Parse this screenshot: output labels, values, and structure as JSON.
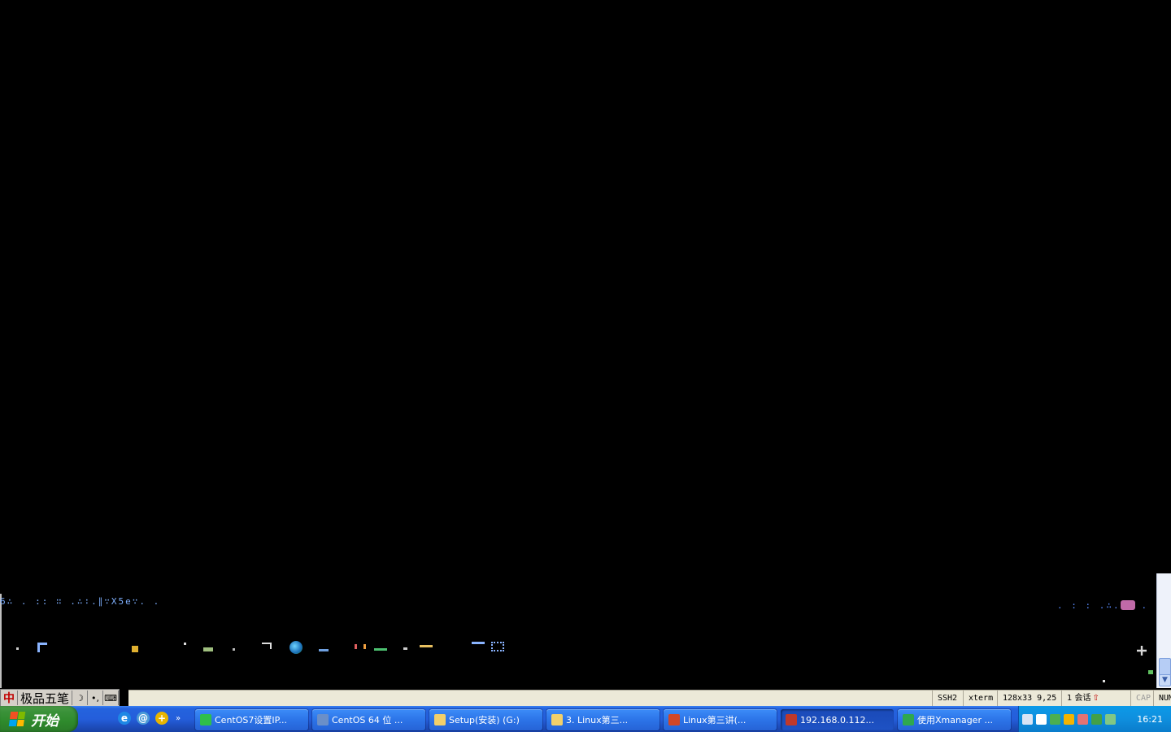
{
  "terminal": {
    "garbled_line_left": "6∴ . :: ∷ .∴∶.∥∵Χ5e∵. .",
    "garbled_line_right": ". : : .∴.:. ."
  },
  "ime": {
    "logo": "中",
    "name": "极品五笔",
    "moon": "☽",
    "punct": "•,",
    "keyboard": "⌨"
  },
  "status_bar": {
    "protocol": "SSH2",
    "terminal_type": "xterm",
    "size_cursor": "128x33  9,25",
    "sessions": "1 会话",
    "sessions_arrow": "⇧",
    "cap": "CAP",
    "num": "NUM"
  },
  "taskbar": {
    "start_label": "开始",
    "quick_launch": [
      {
        "icon": "ie-icon",
        "glyph": "e",
        "color": "#1e88e5"
      },
      {
        "icon": "browser-icon",
        "glyph": "@",
        "color": "#4a9ad8"
      },
      {
        "icon": "plus-icon",
        "glyph": "+",
        "color": "#e8b400"
      }
    ],
    "quick_launch_expand": "»",
    "buttons": [
      {
        "label": "CentOS7设置IP...",
        "icon": "browser-icon",
        "icon_color": "#2fbf4c",
        "active": false
      },
      {
        "label": "CentOS 64 位 ...",
        "icon": "vm-icon",
        "icon_color": "#6b8fc8",
        "active": false
      },
      {
        "label": "Setup(安装) (G:)",
        "icon": "folder-icon",
        "icon_color": "#f2d06b",
        "active": false
      },
      {
        "label": "3. Linux第三...",
        "icon": "folder-icon",
        "icon_color": "#f2d06b",
        "active": false
      },
      {
        "label": "Linux第三讲(...",
        "icon": "powerpoint-icon",
        "icon_color": "#d24726",
        "active": false
      },
      {
        "label": "192.168.0.112...",
        "icon": "xshell-icon",
        "icon_color": "#c0392b",
        "active": true
      },
      {
        "label": "使用Xmanager ...",
        "icon": "xmanager-icon",
        "icon_color": "#2fa84f",
        "active": false
      }
    ],
    "tray_icons": [
      {
        "icon": "keyboard-icon",
        "color": "#d8e4f4"
      },
      {
        "icon": "arrow-left-icon",
        "color": "#ffffff"
      },
      {
        "icon": "network-icon",
        "color": "#4caf50"
      },
      {
        "icon": "qq-icon",
        "color": "#f4b400"
      },
      {
        "icon": "display-icon",
        "color": "#e57373"
      },
      {
        "icon": "shield-icon",
        "color": "#43a047"
      },
      {
        "icon": "security-icon",
        "color": "#81c784"
      }
    ],
    "clock": "16:21"
  },
  "colors": {
    "terminal_bg": "#000000",
    "taskbar_blue": "#245edb",
    "start_green": "#3b923a",
    "tray_blue": "#0f8fde"
  }
}
